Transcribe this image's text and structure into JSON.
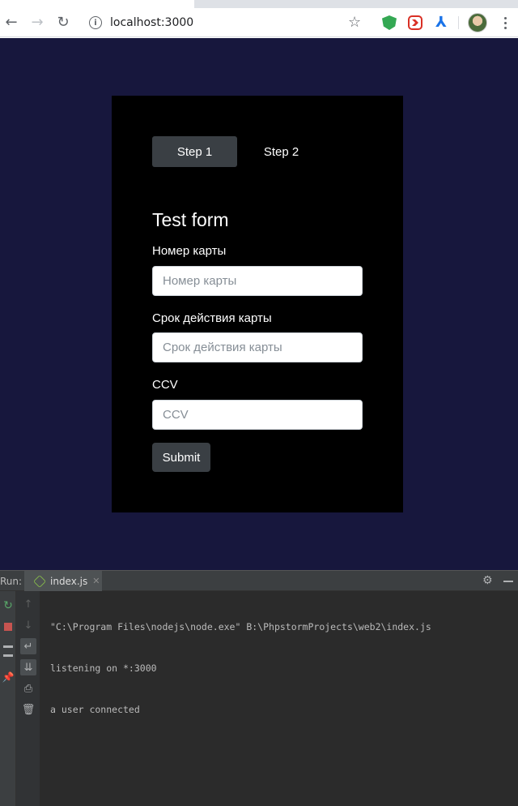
{
  "browser": {
    "url": "localhost:3000",
    "icons": {
      "back": "arrow-left",
      "forward": "arrow-right",
      "reload": "reload",
      "site_info": "info",
      "bookmark": "star",
      "menu": "vertical-dots"
    },
    "extensions": [
      "shield-extension",
      "media-extension",
      "acrobat-extension"
    ]
  },
  "page": {
    "background": "#17173d",
    "card_background": "#000000",
    "steps": [
      {
        "label": "Step 1",
        "active": true
      },
      {
        "label": "Step 2",
        "active": false
      }
    ],
    "form": {
      "title": "Test form",
      "fields": [
        {
          "label": "Номер карты",
          "placeholder": "Номер карты",
          "value": ""
        },
        {
          "label": "Срок действия карты",
          "placeholder": "Срок действия карты",
          "value": ""
        },
        {
          "label": "CCV",
          "placeholder": "CCV",
          "value": ""
        }
      ],
      "submit_label": "Submit"
    }
  },
  "ide": {
    "run_label": "Run:",
    "tab": {
      "label": "index.js",
      "close": "✕"
    },
    "console_lines": [
      "\"C:\\Program Files\\nodejs\\node.exe\" B:\\PhpstormProjects\\web2\\index.js",
      "listening on *:3000",
      "a user connected"
    ],
    "tool_icons": [
      "rerun-icon",
      "stop-icon",
      "layout-icon",
      "pin-icon",
      "up-arrow-icon",
      "down-arrow-icon",
      "soft-wrap-icon",
      "scroll-to-end-icon",
      "print-icon",
      "trash-icon"
    ]
  }
}
